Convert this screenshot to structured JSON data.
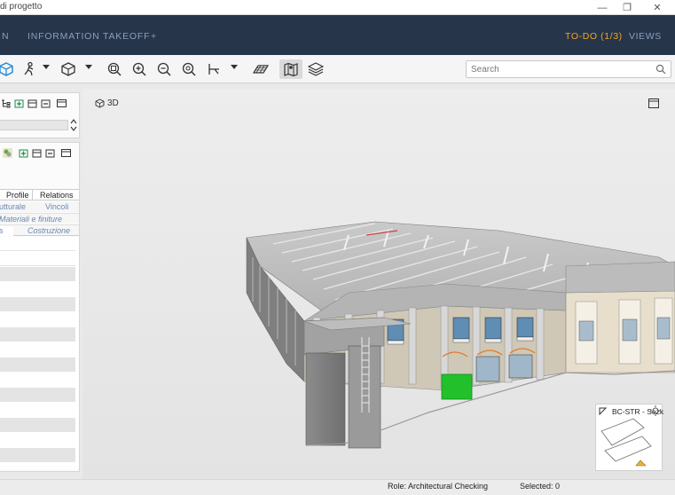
{
  "window": {
    "title": "di progetto",
    "controls": {
      "minimize": "—",
      "restore": "❐",
      "close": "✕"
    }
  },
  "nav": {
    "items": [
      {
        "label": "N"
      },
      {
        "label": "INFORMATION TAKEOFF"
      },
      {
        "label": "+"
      }
    ],
    "todo": "TO-DO (1/3)",
    "views": "VIEWS",
    "todo_color": "#f5a623"
  },
  "toolbar": {
    "icons": [
      "cube-view-icon",
      "walk-icon",
      "box-icon",
      "zoom-fit-icon",
      "zoom-in-icon",
      "zoom-out-icon",
      "zoom-window-icon",
      "measure-icon",
      "section-plane-icon",
      "map-icon",
      "layers-icon"
    ],
    "search_placeholder": "Search"
  },
  "panel_top": {
    "icons": [
      "hierarchy-icon",
      "floor-add-icon",
      "floor-icon",
      "floor-remove-icon",
      "window-icon"
    ]
  },
  "panel_props": {
    "tabs_row1": [
      "Profile",
      "Relations"
    ],
    "tabs_row2": [
      "utturale",
      "Vincoli"
    ],
    "tabs_row3": [
      "Materiali e finiture"
    ],
    "tabs_row4": [
      "s",
      "Costruzione"
    ]
  },
  "viewport": {
    "mode_label": "3D",
    "accent_green": "#22c12b",
    "minimap_label": "BC-STR - Sezk"
  },
  "status": {
    "role": "Role: Architectural Checking",
    "selected": "Selected: 0"
  }
}
